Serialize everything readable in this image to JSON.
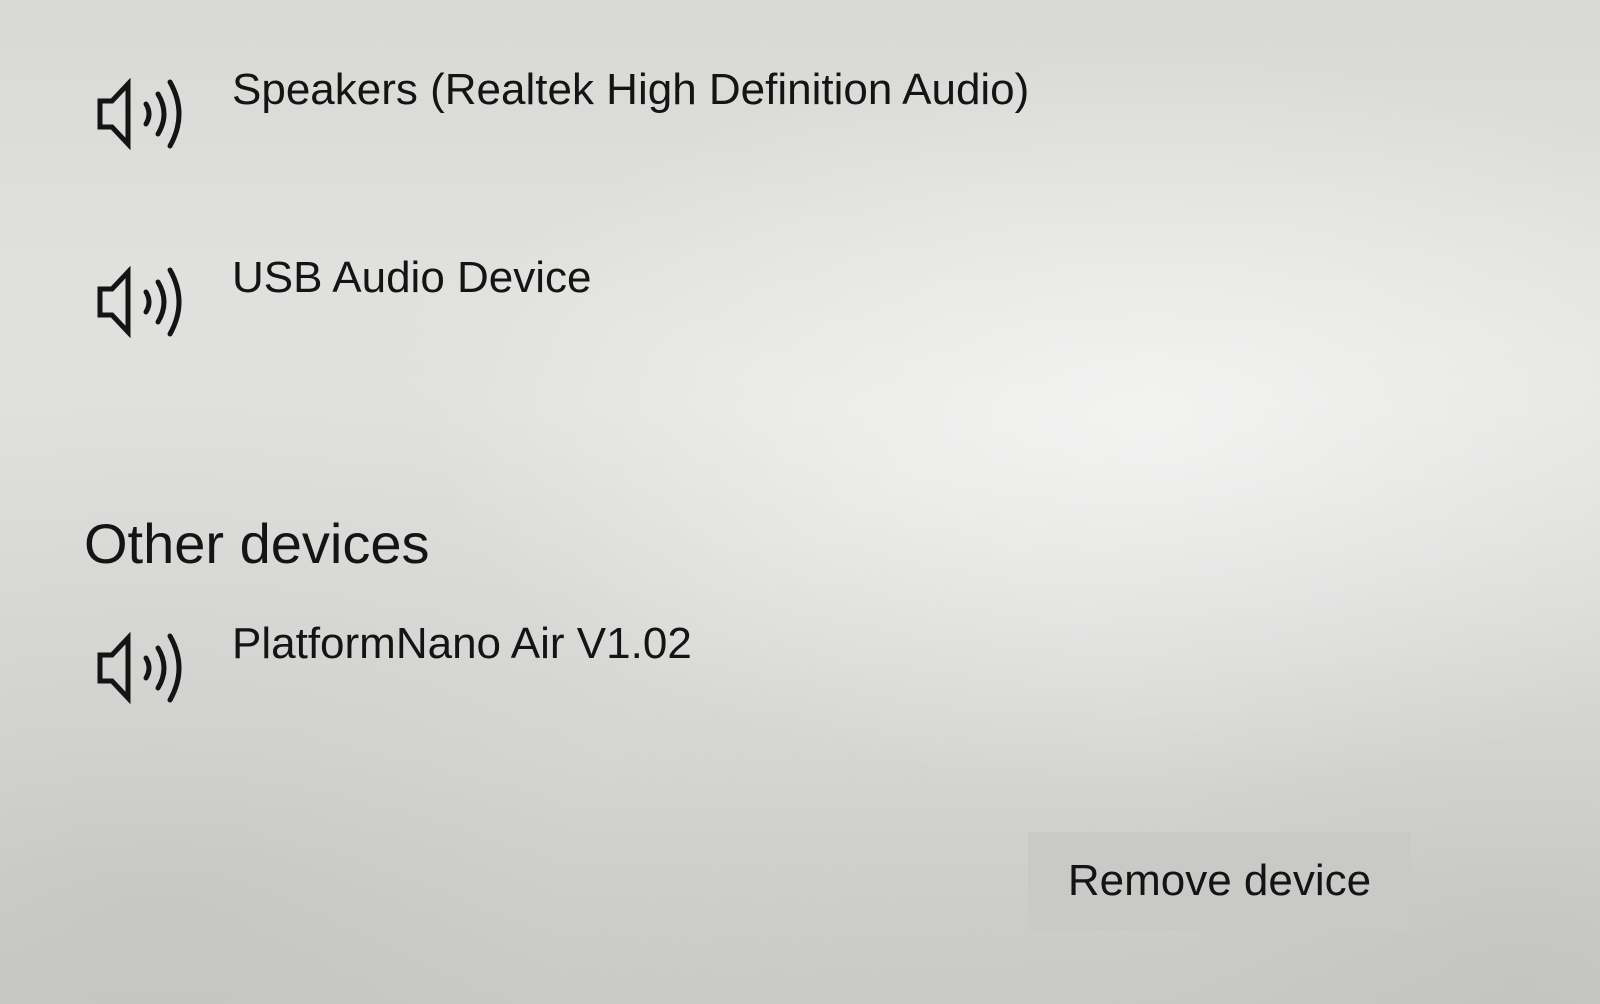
{
  "audio_devices": [
    {
      "label": "Speakers (Realtek High Definition Audio)",
      "icon": "speaker-icon"
    },
    {
      "label": "USB Audio Device",
      "icon": "speaker-icon"
    }
  ],
  "other_devices": {
    "heading": "Other devices",
    "items": [
      {
        "label": "PlatformNano Air V1.02",
        "icon": "speaker-icon"
      }
    ]
  },
  "actions": {
    "remove_label": "Remove device"
  }
}
